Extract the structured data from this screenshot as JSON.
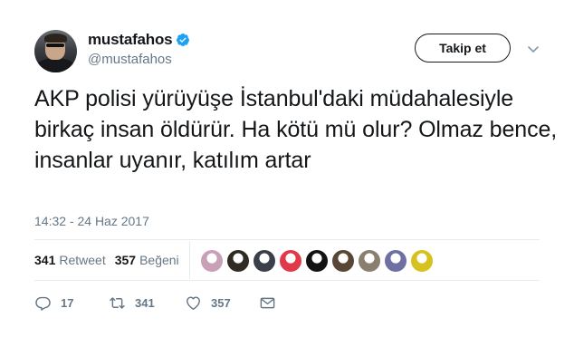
{
  "user": {
    "display_name": "mustafahos",
    "handle": "@mustafahos",
    "verified": true,
    "avatar_icon": "profile-photo-avatar"
  },
  "follow_button": {
    "label": "Takip et"
  },
  "tweet": {
    "text": "AKP polisi yürüyüşe İstanbul'daki müdahalesiyle birkaç insan öldürür. Ha kötü mü olur? Olmaz bence, insanlar uyanır, katılım artar",
    "timestamp": "14:32 - 24 Haz 2017"
  },
  "stats": {
    "retweet_count": "341",
    "retweet_label": "Retweet",
    "like_count": "357",
    "like_label": "Beğeni"
  },
  "liker_avatars": [
    {
      "icon": "liker-avatar",
      "color": "#c9a0b8"
    },
    {
      "icon": "liker-avatar",
      "color": "#2f2a22"
    },
    {
      "icon": "liker-avatar",
      "color": "#3a3f4a"
    },
    {
      "icon": "liker-avatar",
      "color": "#e0394a"
    },
    {
      "icon": "liker-avatar",
      "color": "#121212"
    },
    {
      "icon": "liker-avatar",
      "color": "#5a4634"
    },
    {
      "icon": "liker-avatar",
      "color": "#8a7f6e"
    },
    {
      "icon": "liker-avatar",
      "color": "#6f6fa3"
    },
    {
      "icon": "liker-avatar",
      "color": "#d6c21e"
    }
  ],
  "actions": {
    "reply_count": "17",
    "retweet_count": "341",
    "like_count": "357"
  },
  "colors": {
    "verified_blue": "#1da1f2",
    "muted_text": "#657786",
    "primary_text": "#14171a",
    "divider": "#e6ecf0"
  }
}
